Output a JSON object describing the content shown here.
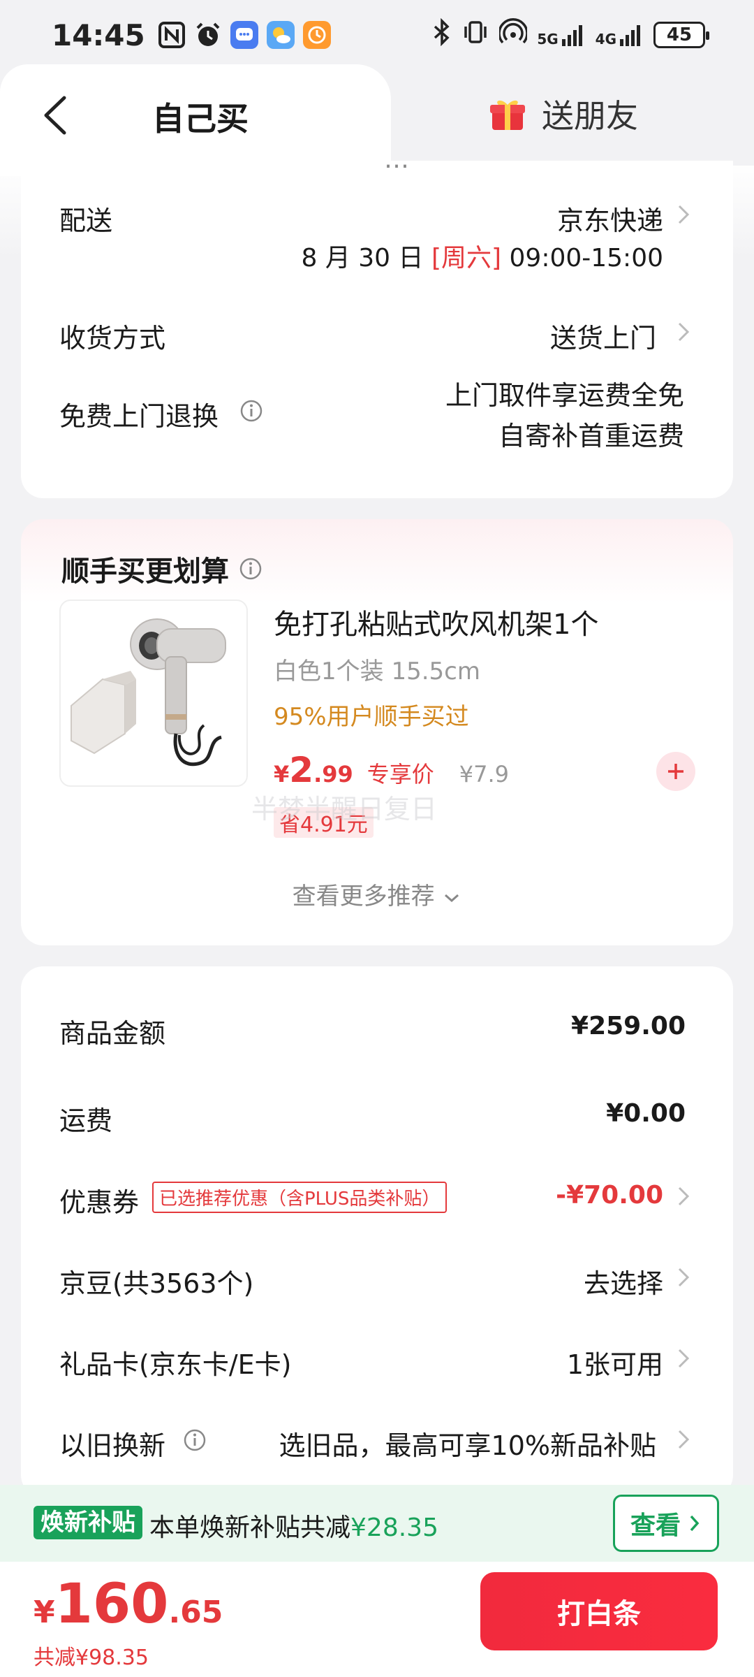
{
  "status_bar": {
    "time": "14:45",
    "network_label_1": "5G",
    "network_label_2": "4G",
    "battery": "45"
  },
  "tabs": {
    "self_buy": "自己买",
    "gift_friend": "送朋友"
  },
  "delivery": {
    "partial_top_text": "…",
    "shipping_label": "配送",
    "shipping_value": "京东快递",
    "date_text": "8 月 30 日",
    "weekday": "[周六]",
    "time_range": "09:00-15:00",
    "receive_label": "收货方式",
    "receive_value": "送货上门",
    "return_label": "免费上门退换",
    "return_line1": "上门取件享运费全免",
    "return_line2": "自寄补首重运费"
  },
  "addon": {
    "section_title": "顺手买更划算",
    "product_name": "免打孔粘贴式吹风机架1个",
    "product_spec": "白色1个装 15.5cm",
    "product_stat": "95%用户顺手买过",
    "price_symbol": "¥",
    "price_int": "2",
    "price_dec": ".99",
    "price_tag": "专享价",
    "orig_price": "¥7.9",
    "save_text": "省4.91元",
    "watermark": "半梦半醒日复日",
    "more_link": "查看更多推荐"
  },
  "summary": {
    "goods_label": "商品金额",
    "goods_value": "¥259.00",
    "freight_label": "运费",
    "freight_value": "¥0.00",
    "coupon_label": "优惠券",
    "coupon_tag": "已选推荐优惠（含PLUS品类补贴）",
    "coupon_value": "-¥70.00",
    "bean_label": "京豆(共3563个)",
    "bean_value": "去选择",
    "card_label": "礼品卡(京东卡/E卡)",
    "card_value": "1张可用",
    "tradein_label": "以旧换新",
    "tradein_value": "选旧品，最高可享10%新品补贴"
  },
  "subsidy": {
    "tag": "焕新补贴",
    "text_prefix": "本单焕新补贴共减",
    "amount": "¥28.35",
    "button": "查看"
  },
  "pay": {
    "symbol": "¥",
    "amount_int": "160",
    "amount_dec": ".65",
    "total_saved": "共减¥98.35",
    "button": "打白条"
  },
  "colors": {
    "accent_red": "#e4393c",
    "subsidy_green": "#19a25a",
    "orange_stat": "#d4891f"
  }
}
